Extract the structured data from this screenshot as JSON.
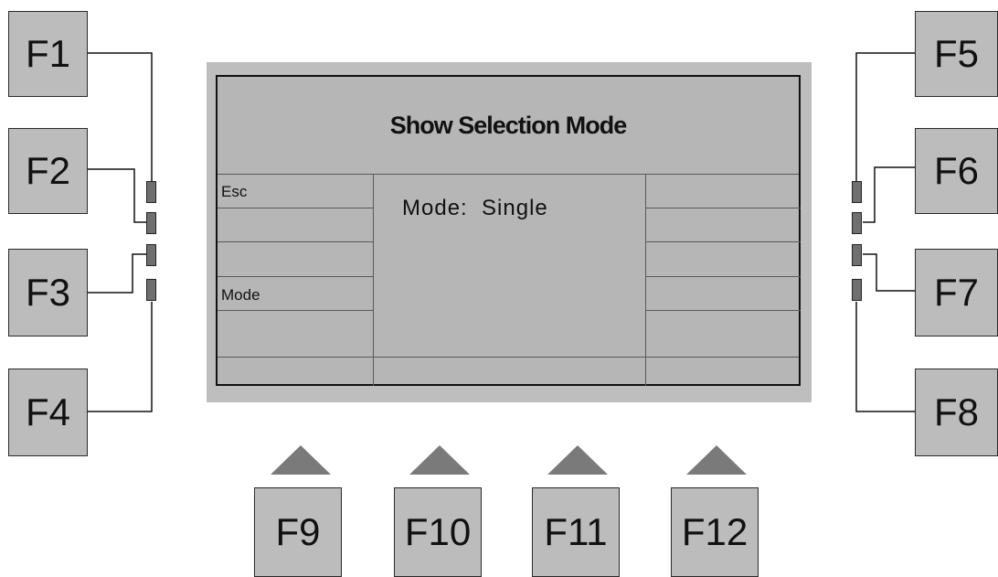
{
  "function_keys": {
    "f1": "F1",
    "f2": "F2",
    "f3": "F3",
    "f4": "F4",
    "f5": "F5",
    "f6": "F6",
    "f7": "F7",
    "f8": "F8",
    "f9": "F9",
    "f10": "F10",
    "f11": "F11",
    "f12": "F12"
  },
  "screen": {
    "title": "Show Selection Mode",
    "left_softkeys": [
      "Esc",
      "",
      "",
      "Mode",
      ""
    ],
    "main_text": "Mode:  Single"
  },
  "colors": {
    "key_fill": "#bcbcbc",
    "panel_fill": "#bebebe",
    "screen_fill": "#b6b6b6",
    "indicator_fill": "#6f6f6f",
    "arrow_fill": "#7a7a7a"
  }
}
